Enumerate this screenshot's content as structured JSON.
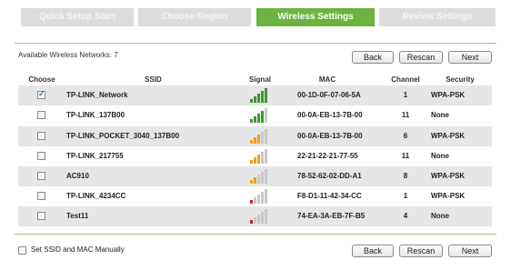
{
  "tabs": [
    {
      "label": "Quick Setup Start",
      "active": false
    },
    {
      "label": "Choose Region",
      "active": false
    },
    {
      "label": "Wireless Settings",
      "active": true
    },
    {
      "label": "Review Settings",
      "active": false
    }
  ],
  "available_label": "Available Wireless Networks: 7",
  "buttons": {
    "back": "Back",
    "rescan": "Rescan",
    "next": "Next"
  },
  "columns": {
    "choose": "Choose",
    "ssid": "SSID",
    "signal": "Signal",
    "mac": "MAC",
    "channel": "Channel",
    "security": "Security"
  },
  "networks": [
    {
      "ssid": "TP-LINK_Network",
      "mac": "00-1D-0F-07-06-5A",
      "channel": "1",
      "security": "WPA-PSK",
      "selected": true,
      "signal_bars": 5,
      "signal_color": "#3a9a2a"
    },
    {
      "ssid": "TP-LINK_137B00",
      "mac": "00-0A-EB-13-7B-00",
      "channel": "11",
      "security": "None",
      "selected": false,
      "signal_bars": 4,
      "signal_color": "#3a9a2a"
    },
    {
      "ssid": "TP-LINK_POCKET_3040_137B00",
      "mac": "00-0A-EB-13-7B-00",
      "channel": "6",
      "security": "WPA-PSK",
      "selected": false,
      "signal_bars": 3,
      "signal_color": "#f0a020"
    },
    {
      "ssid": "TP-LINK_217755",
      "mac": "22-21-22-21-77-55",
      "channel": "11",
      "security": "None",
      "selected": false,
      "signal_bars": 3,
      "signal_color": "#f0a020"
    },
    {
      "ssid": "AC910",
      "mac": "78-52-62-02-DD-A1",
      "channel": "8",
      "security": "WPA-PSK",
      "selected": false,
      "signal_bars": 2,
      "signal_color": "#f0a020"
    },
    {
      "ssid": "TP-LINK_4234CC",
      "mac": "F8-D1-11-42-34-CC",
      "channel": "1",
      "security": "WPA-PSK",
      "selected": false,
      "signal_bars": 1,
      "signal_color": "#cc2222"
    },
    {
      "ssid": "Test11",
      "mac": "74-EA-3A-EB-7F-B5",
      "channel": "4",
      "security": "None",
      "selected": false,
      "signal_bars": 1,
      "signal_color": "#cc2222"
    }
  ],
  "signal_inactive_color": "#c8c8c8",
  "manual_label": "Set SSID and MAC Manually"
}
